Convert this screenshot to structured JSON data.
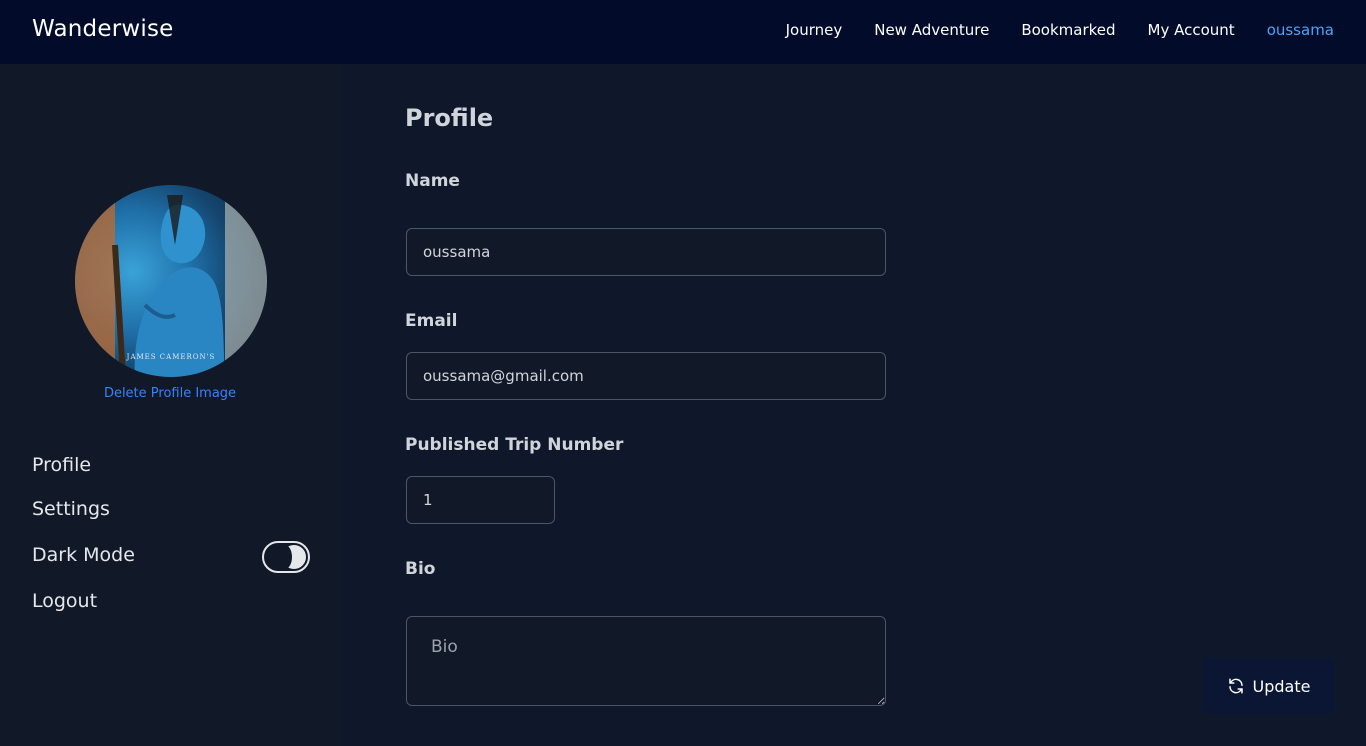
{
  "app": {
    "brand": "Wanderwise"
  },
  "nav": {
    "items": [
      {
        "label": "Journey"
      },
      {
        "label": "New Adventure"
      },
      {
        "label": "Bookmarked"
      },
      {
        "label": "My Account"
      },
      {
        "label": "oussama"
      }
    ],
    "active_index": 4
  },
  "sidebar": {
    "avatar_caption": "JAMES CAMERON'S",
    "delete_image_label": "Delete Profile Image",
    "items": [
      {
        "label": "Profile"
      },
      {
        "label": "Settings"
      },
      {
        "label": "Dark Mode"
      },
      {
        "label": "Logout"
      }
    ],
    "dark_mode_enabled": true
  },
  "profile": {
    "title": "Profile",
    "name_label": "Name",
    "name_value": "oussama",
    "email_label": "Email",
    "email_value": "oussama@gmail.com",
    "trips_label": "Published Trip Number",
    "trips_value": "1",
    "bio_label": "Bio",
    "bio_placeholder": "Bio"
  },
  "actions": {
    "update_label": "Update"
  },
  "colors": {
    "background": "#0f172a",
    "topbar": "#020b2a",
    "sidebar": "#111827",
    "accent": "#4ea3f5",
    "link": "#3b82f6"
  }
}
